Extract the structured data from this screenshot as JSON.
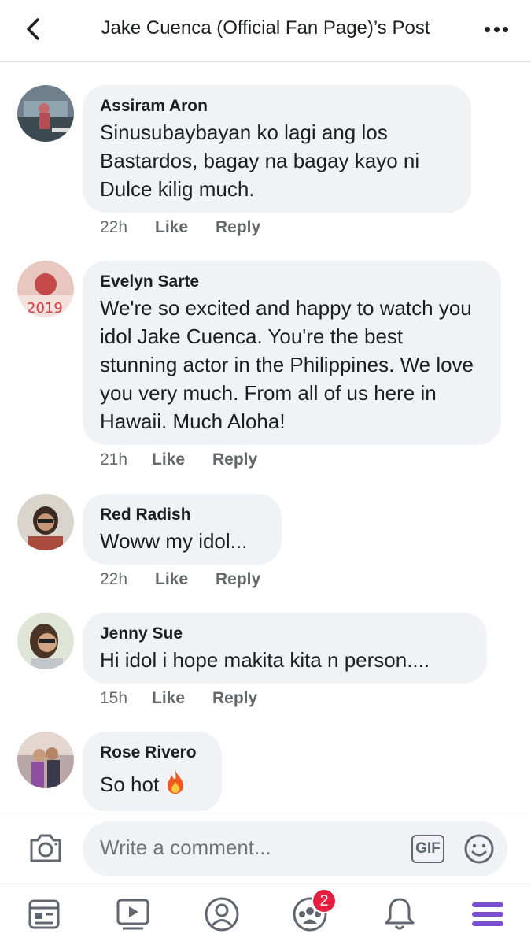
{
  "header": {
    "title": "Jake Cuenca (Official Fan Page)’s Post"
  },
  "comments": [
    {
      "author": "Assiram Aron",
      "text": "Sinusubaybayan ko lagi ang los Bastardos, bagay na bagay kayo ni Dulce kilig much.",
      "time": "22h",
      "like": "Like",
      "reply": "Reply"
    },
    {
      "author": "Evelyn Sarte",
      "text": "We're so excited and happy to watch you idol Jake Cuenca. You're the best stunning actor in the Philippines. We love you very much. From all of us here in Hawaii. Much Aloha!",
      "time": "21h",
      "like": "Like",
      "reply": "Reply"
    },
    {
      "author": "Red Radish",
      "text": "Woww my idol...",
      "time": "22h",
      "like": "Like",
      "reply": "Reply"
    },
    {
      "author": "Jenny Sue",
      "text": "Hi idol i hope makita kita n person....",
      "time": "15h",
      "like": "Like",
      "reply": "Reply"
    },
    {
      "author": "Rose Rivero",
      "text": "So hot",
      "emoji": "fire-emoji"
    }
  ],
  "composer": {
    "placeholder": "Write a comment...",
    "gif_label": "GIF"
  },
  "bottom_nav": {
    "items": [
      "news-feed-icon",
      "watch-icon",
      "profile-icon",
      "groups-icon",
      "notifications-icon",
      "menu-icon"
    ],
    "groups_badge": "2",
    "active_color": "#7b4fd1"
  },
  "colors": {
    "bubble": "#f0f2f5",
    "secondary_text": "#65676b",
    "badge": "#e41e3f"
  }
}
